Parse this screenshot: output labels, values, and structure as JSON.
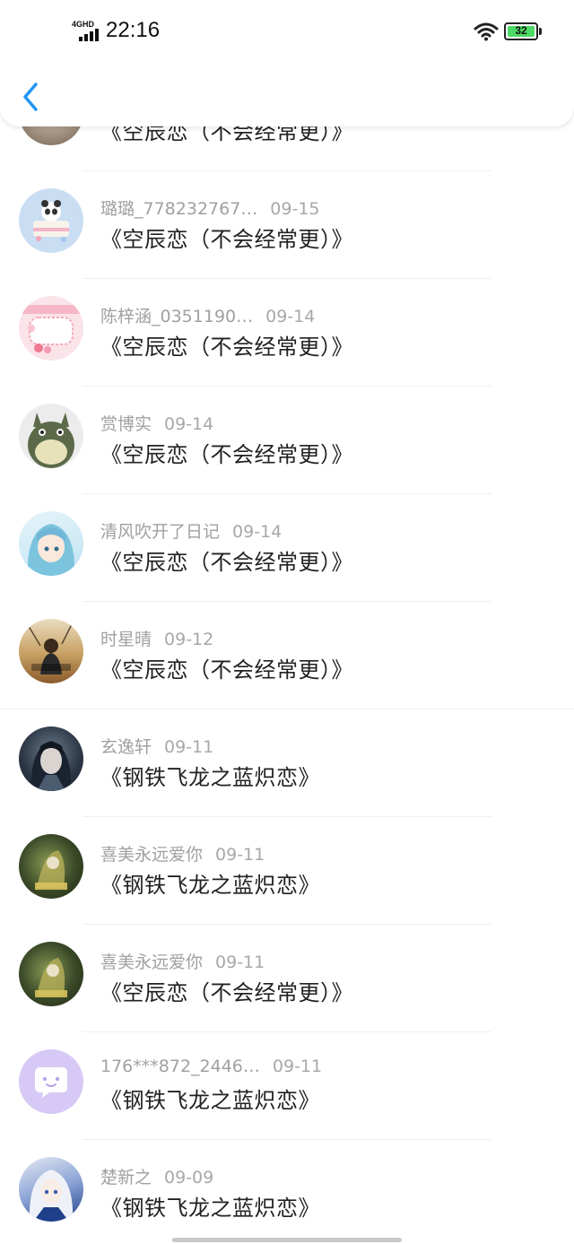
{
  "status_bar": {
    "time": "22:16",
    "network": "4GHD",
    "battery": "32"
  },
  "header": {
    "back_icon": "chevron-left-icon"
  },
  "comments": [
    {
      "user": "",
      "date": "",
      "title": "《空辰恋（不会经常更）》",
      "avatar_colors": [
        "#8f7f6e",
        "#d8cdbf"
      ]
    },
    {
      "user": "璐璐_778232767…",
      "date": "09-15",
      "title": "《空辰恋（不会经常更）》",
      "avatar_colors": [
        "#c9ddf3",
        "#f2c2cf"
      ]
    },
    {
      "user": "陈梓涵_0351190…",
      "date": "09-14",
      "title": "《空辰恋（不会经常更）》",
      "avatar_colors": [
        "#fbe3ea",
        "#f5b7c6"
      ]
    },
    {
      "user": "赏博实",
      "date": "09-14",
      "title": "《空辰恋（不会经常更）》",
      "avatar_colors": [
        "#e8e8e8",
        "#5c6a4a"
      ]
    },
    {
      "user": "清风吹开了日记",
      "date": "09-14",
      "title": "《空辰恋（不会经常更）》",
      "avatar_colors": [
        "#d7eef7",
        "#6fb6d8"
      ]
    },
    {
      "user": "时星晴",
      "date": "09-12",
      "title": "《空辰恋（不会经常更）》",
      "avatar_colors": [
        "#c7a062",
        "#3b2a1c"
      ]
    },
    {
      "user": "玄逸轩",
      "date": "09-11",
      "title": "《钢铁飞龙之蓝炽恋》",
      "avatar_colors": [
        "#1e2a3a",
        "#6a7b8c"
      ]
    },
    {
      "user": "喜美永远爱你",
      "date": "09-11",
      "title": "《钢铁飞龙之蓝炽恋》",
      "avatar_colors": [
        "#2f3a22",
        "#b8b05a"
      ]
    },
    {
      "user": "喜美永远爱你",
      "date": "09-11",
      "title": "《空辰恋（不会经常更）》",
      "avatar_colors": [
        "#2f3a22",
        "#b8b05a"
      ]
    },
    {
      "user": "176***872_2446…",
      "date": "09-11",
      "title": "《钢铁飞龙之蓝炽恋》",
      "avatar_colors": [
        "#d7c9f5",
        "#d7c9f5"
      ]
    },
    {
      "user": "楚新之",
      "date": "09-09",
      "title": "《钢铁飞龙之蓝炽恋》",
      "avatar_colors": [
        "#1f3f8a",
        "#e4e9f3"
      ]
    }
  ]
}
